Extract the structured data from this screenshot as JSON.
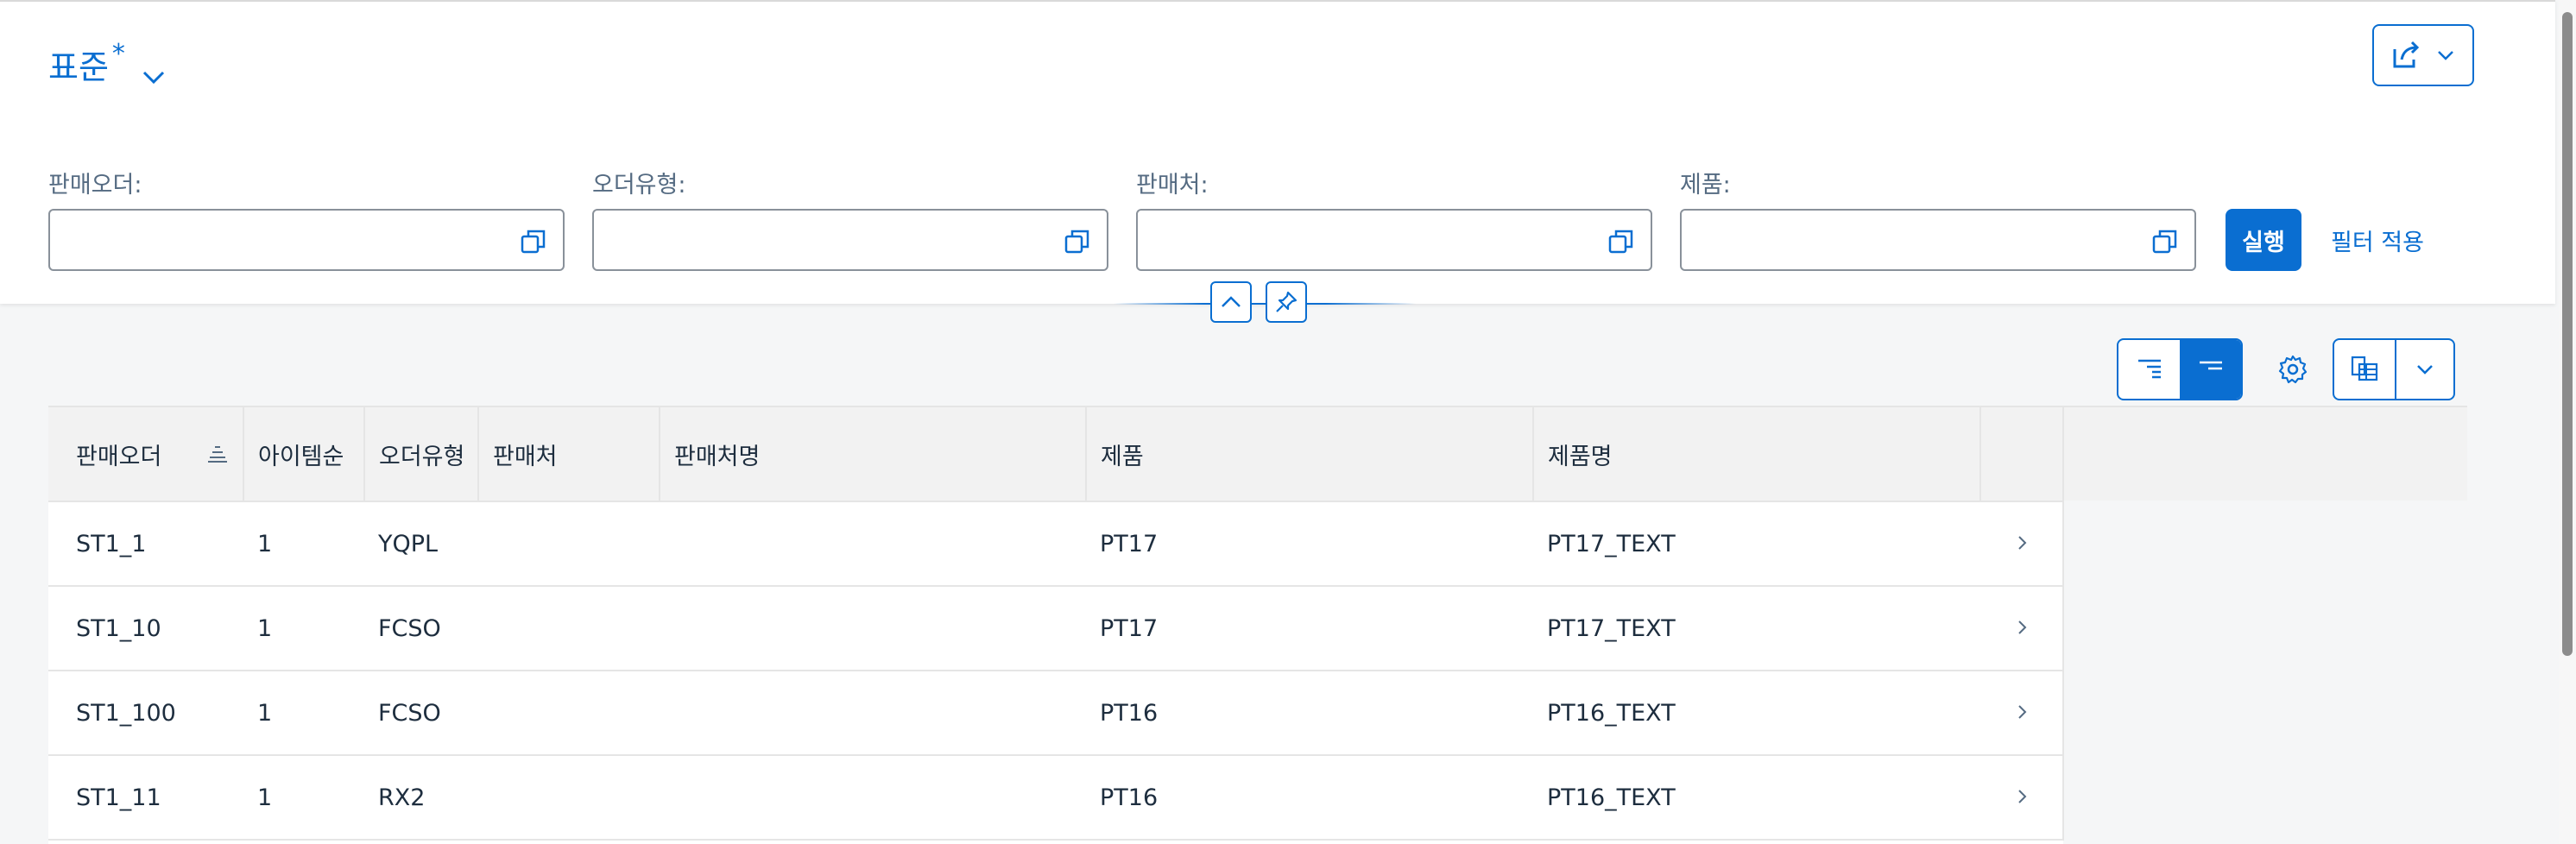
{
  "variant": {
    "title": "표준",
    "modified_marker": "*"
  },
  "filters": [
    {
      "label": "판매오더:",
      "value": ""
    },
    {
      "label": "오더유형:",
      "value": ""
    },
    {
      "label": "판매처:",
      "value": ""
    },
    {
      "label": "제품:",
      "value": ""
    }
  ],
  "actions": {
    "go_label": "실행",
    "adapt_label": "필터 적용"
  },
  "colors": {
    "accent": "#0a6ed1",
    "header_bg": "#f2f2f2",
    "page_bg": "#f5f6f7"
  },
  "table": {
    "columns": [
      "판매오더",
      "아이템순",
      "오더유형",
      "판매처",
      "판매처명",
      "제품",
      "제품명"
    ],
    "sorted_column": "판매오더",
    "rows": [
      {
        "order": "ST1_1",
        "item": "1",
        "type": "YQPL",
        "customer": "",
        "customer_name": "",
        "product": "PT17",
        "product_name": "PT17_TEXT"
      },
      {
        "order": "ST1_10",
        "item": "1",
        "type": "FCSO",
        "customer": "",
        "customer_name": "",
        "product": "PT17",
        "product_name": "PT17_TEXT"
      },
      {
        "order": "ST1_100",
        "item": "1",
        "type": "FCSO",
        "customer": "",
        "customer_name": "",
        "product": "PT16",
        "product_name": "PT16_TEXT"
      },
      {
        "order": "ST1_11",
        "item": "1",
        "type": "RX2",
        "customer": "",
        "customer_name": "",
        "product": "PT16",
        "product_name": "PT16_TEXT"
      }
    ]
  },
  "icons": {
    "variant_dropdown": "chevron-down-icon",
    "share": "share-icon",
    "value_help": "value-help-icon",
    "collapse": "chevron-up-icon",
    "pin": "pin-icon",
    "show_details": "show-details-icon",
    "hide_details": "hide-details-icon",
    "settings": "gear-icon",
    "export": "export-icon",
    "row_nav": "chevron-right-icon",
    "sort": "sort-ascending-icon"
  }
}
